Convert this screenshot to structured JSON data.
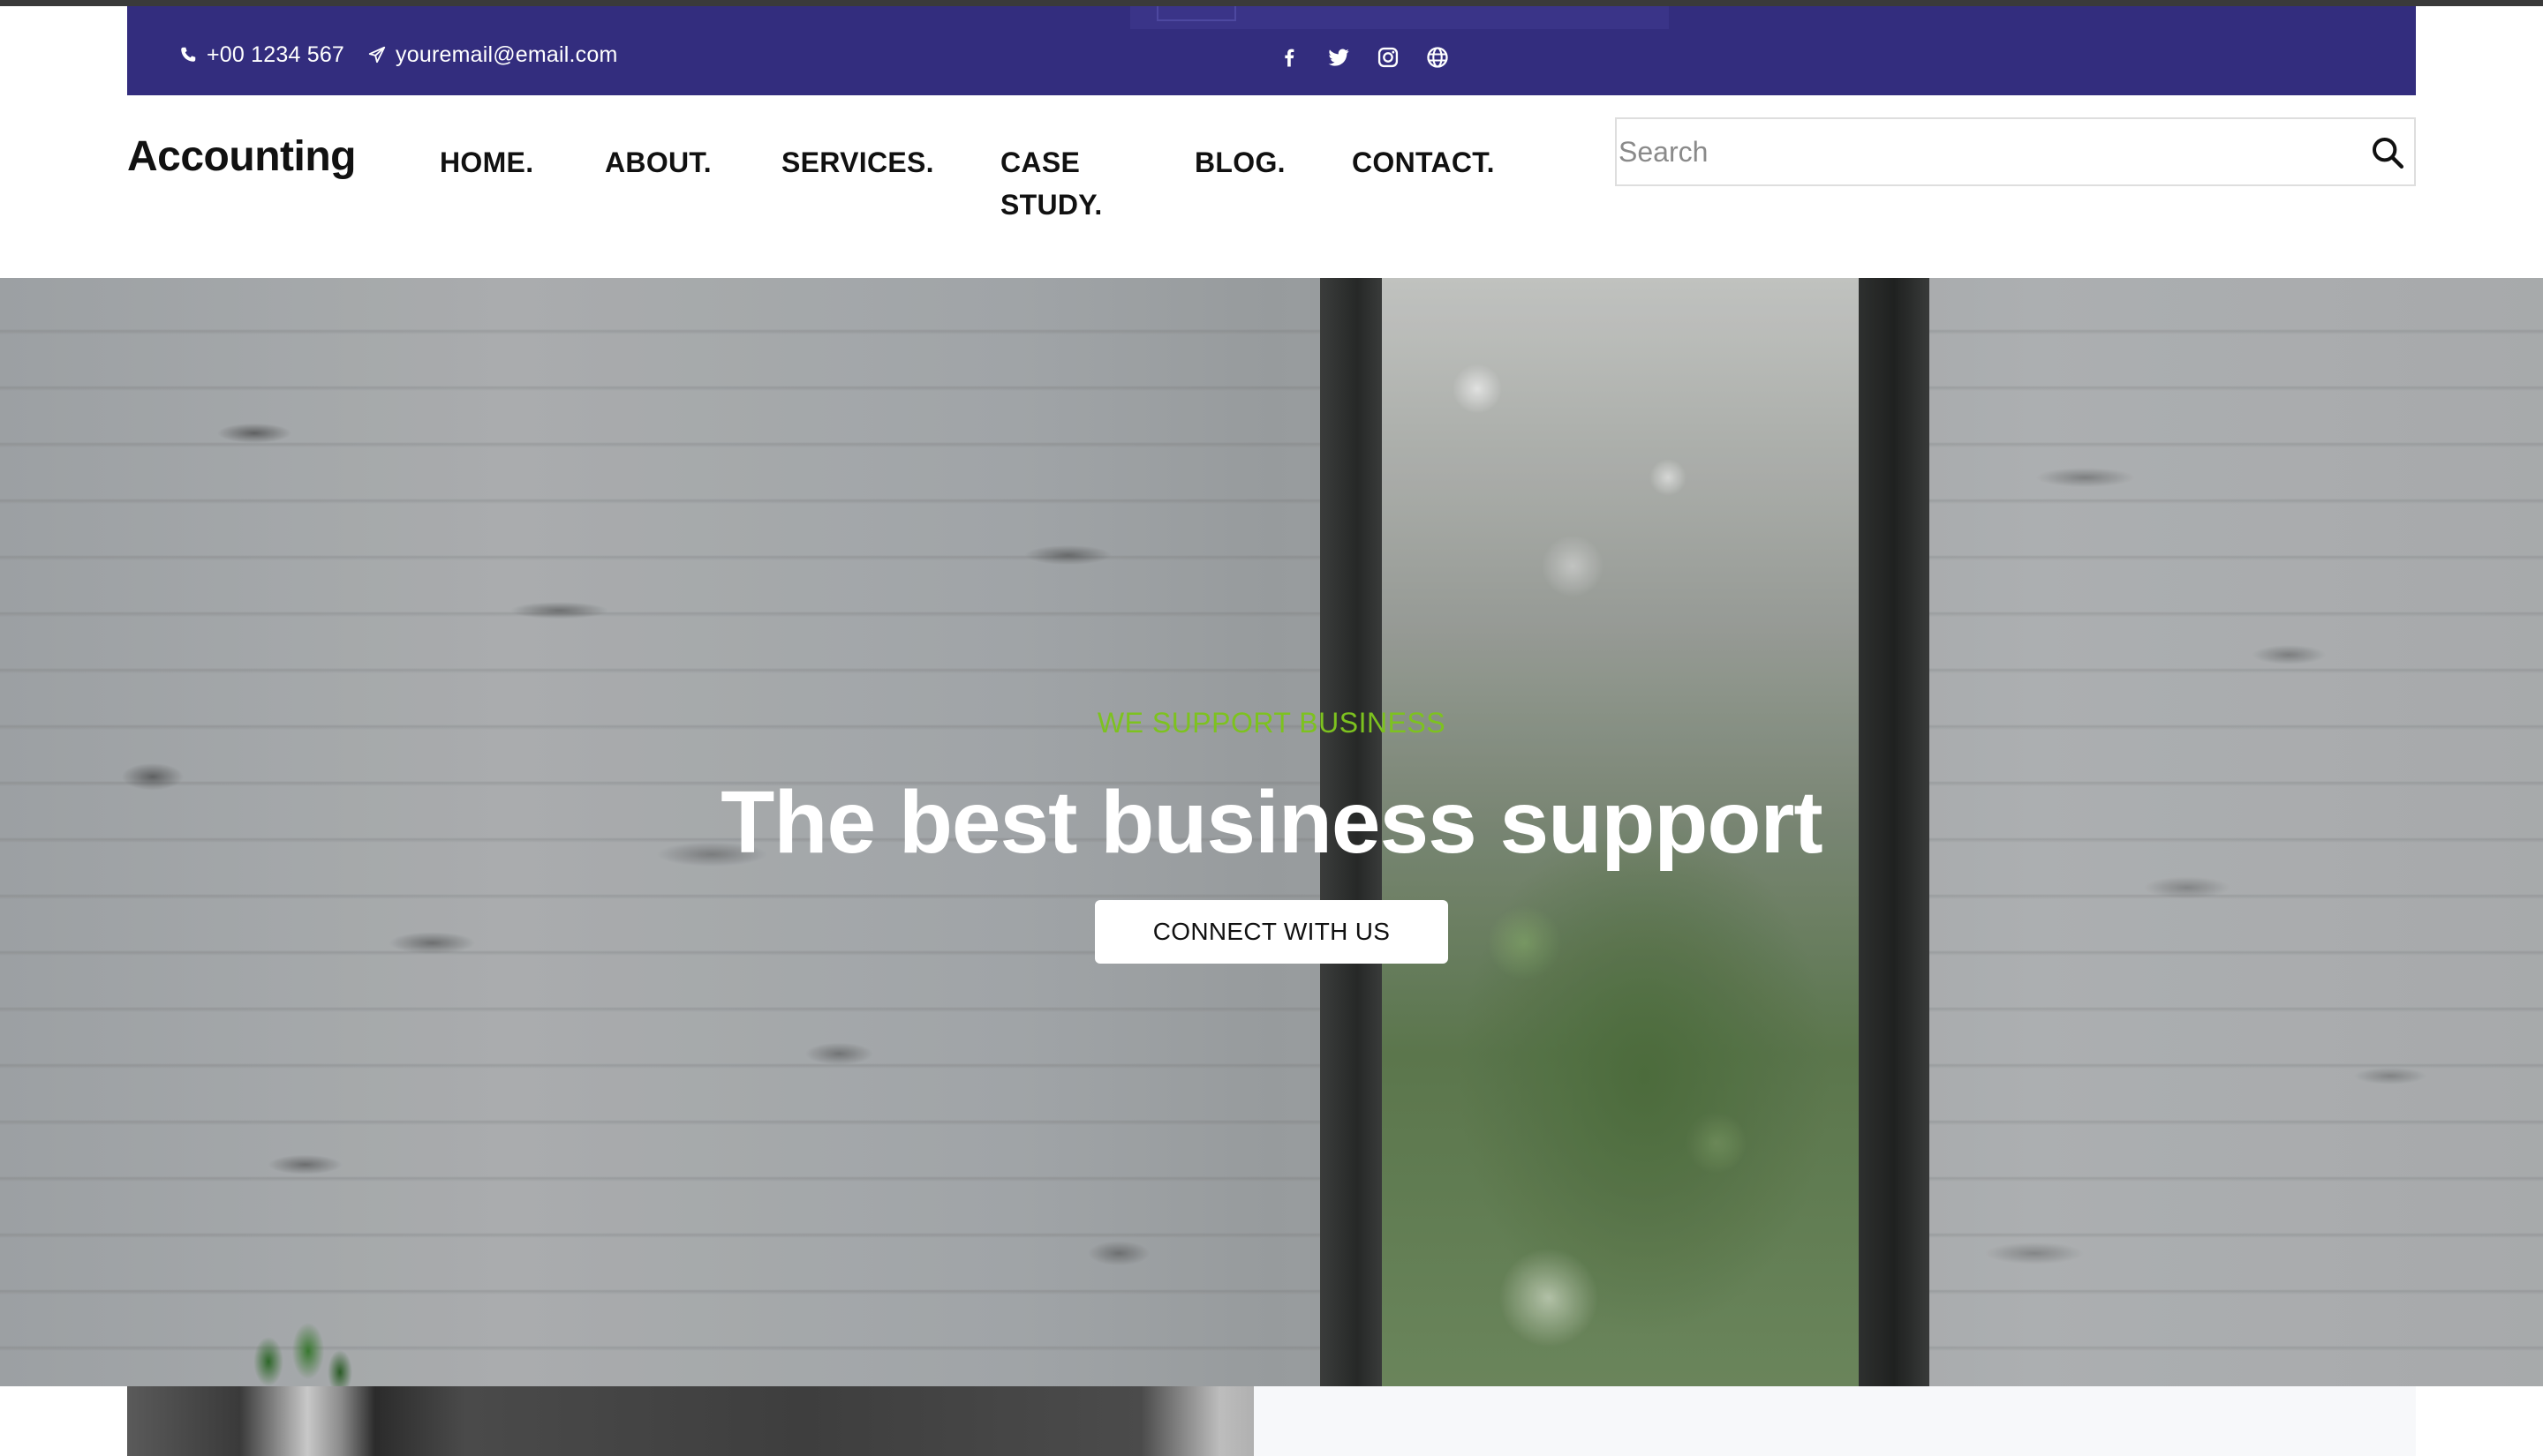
{
  "topbar": {
    "phone": "+00 1234 567",
    "email": "youremail@email.com",
    "background_color": "#332d7e",
    "social_icons": [
      "facebook-icon",
      "twitter-icon",
      "instagram-icon",
      "globe-icon"
    ]
  },
  "header": {
    "logo": "Accounting",
    "nav": [
      {
        "label": "HOME."
      },
      {
        "label": "ABOUT."
      },
      {
        "label": "SERVICES."
      },
      {
        "label": "CASE STUDY."
      },
      {
        "label": "BLOG."
      },
      {
        "label": "CONTACT."
      }
    ],
    "search": {
      "placeholder": "Search",
      "value": "",
      "icon": "search-icon"
    }
  },
  "hero": {
    "kicker": "WE SUPPORT BUSINESS",
    "title": "The best business support",
    "button_label": "CONNECT WITH US",
    "kicker_color": "#7dc21f"
  }
}
